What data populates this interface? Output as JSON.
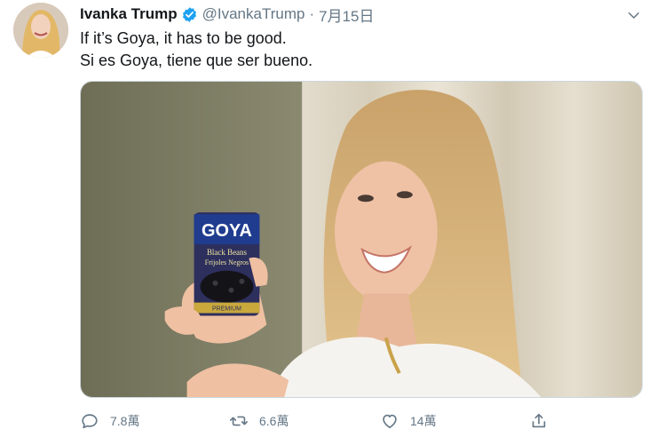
{
  "tweet": {
    "display_name": "Ivanka Trump",
    "handle": "@IvankaTrump",
    "separator": "·",
    "date": "7月15日",
    "lines": [
      "If it’s Goya, it has to be good.",
      "Si es Goya, tiene que ser bueno."
    ],
    "verified": true,
    "media": {
      "can_brand": "GOYA",
      "can_line1": "Black Beans",
      "can_line2": "Frijoles Negros",
      "can_bottom": "PREMIUM"
    }
  },
  "actions": {
    "reply_icon": "reply-icon",
    "reply_count": "7.8萬",
    "retweet_icon": "retweet-icon",
    "retweet_count": "6.6萬",
    "like_icon": "heart-icon",
    "like_count": "14萬",
    "share_icon": "share-icon"
  },
  "colors": {
    "verified": "#1da1f2",
    "secondary_text": "#657786",
    "primary_text": "#14171a"
  }
}
